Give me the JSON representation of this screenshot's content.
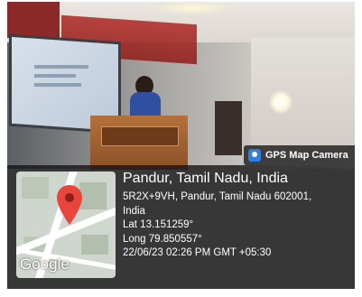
{
  "overlay": {
    "app_badge": "GPS Map Camera",
    "title": "Pandur, Tamil Nadu, India",
    "address_line1": "5R2X+9VH, Pandur, Tamil Nadu 602001,",
    "address_line2": "India",
    "lat": "Lat 13.151259°",
    "long": "Long 79.850557°",
    "datetime": "22/06/23 02:26 PM GMT +05:30",
    "map_logo": "Google"
  },
  "icons": {
    "badge_icon": "gps-map-camera-icon",
    "pin_icon": "map-pin-icon"
  },
  "colors": {
    "pin": "#e8453c",
    "badge_icon": "#2c7fe0"
  }
}
